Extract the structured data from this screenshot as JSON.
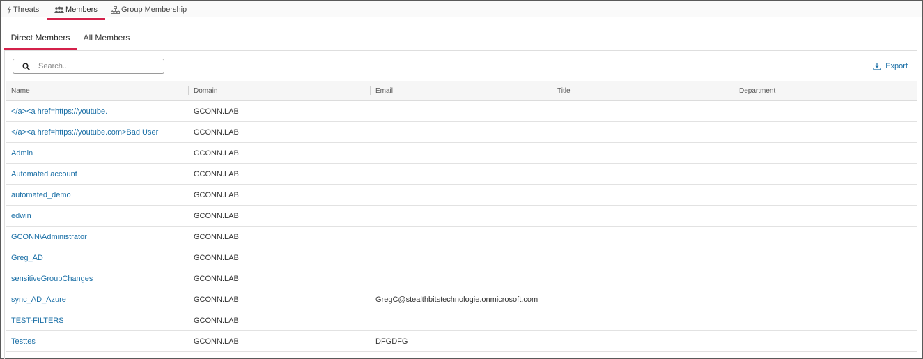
{
  "top_tabs": [
    {
      "label": "Threats",
      "icon": "lightning-icon",
      "active": false
    },
    {
      "label": "Members",
      "icon": "users-icon",
      "active": true
    },
    {
      "label": "Group Membership",
      "icon": "hierarchy-icon",
      "active": false
    }
  ],
  "sub_tabs": [
    {
      "label": "Direct Members",
      "active": true
    },
    {
      "label": "All Members",
      "active": false
    }
  ],
  "search": {
    "placeholder": "Search...",
    "value": ""
  },
  "export": {
    "label": "Export"
  },
  "table": {
    "columns": [
      "Name",
      "Domain",
      "Email",
      "Title",
      "Department"
    ],
    "rows": [
      {
        "name": "</a><a href=https://youtube.",
        "domain": "GCONN.LAB",
        "email": "",
        "title": "",
        "department": ""
      },
      {
        "name": "</a><a href=https://youtube.com>Bad User",
        "domain": "GCONN.LAB",
        "email": "",
        "title": "",
        "department": ""
      },
      {
        "name": "Admin",
        "domain": "GCONN.LAB",
        "email": "",
        "title": "",
        "department": ""
      },
      {
        "name": "Automated account",
        "domain": "GCONN.LAB",
        "email": "",
        "title": "",
        "department": ""
      },
      {
        "name": "automated_demo",
        "domain": "GCONN.LAB",
        "email": "",
        "title": "",
        "department": ""
      },
      {
        "name": "edwin",
        "domain": "GCONN.LAB",
        "email": "",
        "title": "",
        "department": ""
      },
      {
        "name": "GCONN\\Administrator",
        "domain": "GCONN.LAB",
        "email": "",
        "title": "",
        "department": ""
      },
      {
        "name": "Greg_AD",
        "domain": "GCONN.LAB",
        "email": "",
        "title": "",
        "department": ""
      },
      {
        "name": "sensitiveGroupChanges",
        "domain": "GCONN.LAB",
        "email": "",
        "title": "",
        "department": ""
      },
      {
        "name": "sync_AD_Azure",
        "domain": "GCONN.LAB",
        "email": "GregC@stealthbitstechnologie.onmicrosoft.com",
        "title": "",
        "department": ""
      },
      {
        "name": "TEST-FILTERS",
        "domain": "GCONN.LAB",
        "email": "",
        "title": "",
        "department": ""
      },
      {
        "name": "Testtes",
        "domain": "GCONN.LAB",
        "email": "DFGDFG",
        "title": "",
        "department": ""
      }
    ]
  },
  "colors": {
    "accent": "#d4204a",
    "link": "#1a6fa6"
  }
}
